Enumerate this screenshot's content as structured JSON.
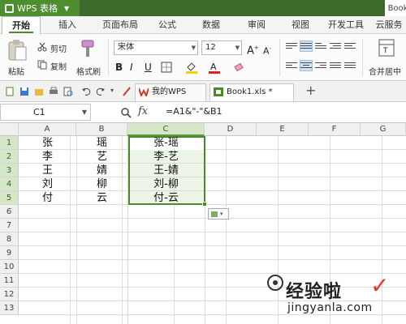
{
  "app": {
    "title": "WPS 表格",
    "right_label": "Book"
  },
  "ribbon_tabs": [
    "开始",
    "插入",
    "页面布局",
    "公式",
    "数据",
    "审阅",
    "视图",
    "开发工具",
    "云服务"
  ],
  "ribbon": {
    "paste": "粘贴",
    "cut": "剪切",
    "copy": "复制",
    "format_painter": "格式刷",
    "font_name": "宋体",
    "font_size": "12",
    "bold": "B",
    "italic": "I",
    "underline": "U",
    "merge_center": "合并居中"
  },
  "quickbar": {
    "tabs": [
      {
        "label": "我的WPS",
        "icon": "wps-logo-icon"
      },
      {
        "label": "Book1.xls *",
        "icon": "spreadsheet-icon"
      }
    ]
  },
  "formula_bar": {
    "cell_ref": "C1",
    "fx": "fx",
    "formula": "=A1&\"-\"&B1"
  },
  "grid": {
    "columns": [
      "A",
      "B",
      "C",
      "D",
      "E",
      "F",
      "G"
    ],
    "rows": [
      "1",
      "2",
      "3",
      "4",
      "5",
      "6",
      "7",
      "8",
      "9",
      "10",
      "11",
      "12",
      "13"
    ],
    "cells": [
      {
        "col": "A",
        "row": 1,
        "value": "张"
      },
      {
        "col": "B",
        "row": 1,
        "value": "瑶"
      },
      {
        "col": "C",
        "row": 1,
        "value": "张-瑶"
      },
      {
        "col": "A",
        "row": 2,
        "value": "李"
      },
      {
        "col": "B",
        "row": 2,
        "value": "艺"
      },
      {
        "col": "C",
        "row": 2,
        "value": "李-艺"
      },
      {
        "col": "A",
        "row": 3,
        "value": "王"
      },
      {
        "col": "B",
        "row": 3,
        "value": "婧"
      },
      {
        "col": "C",
        "row": 3,
        "value": "王-婧"
      },
      {
        "col": "A",
        "row": 4,
        "value": "刘"
      },
      {
        "col": "B",
        "row": 4,
        "value": "柳"
      },
      {
        "col": "C",
        "row": 4,
        "value": "刘-柳"
      },
      {
        "col": "A",
        "row": 5,
        "value": "付"
      },
      {
        "col": "B",
        "row": 5,
        "value": "云"
      },
      {
        "col": "C",
        "row": 5,
        "value": "付-云"
      }
    ]
  },
  "watermark": {
    "text": "经验啦",
    "url": "jingyanla.com"
  },
  "colors": {
    "accent": "#4a8a2a",
    "titlebar": "#3b6a2a",
    "selection": "#d6e6c8"
  }
}
